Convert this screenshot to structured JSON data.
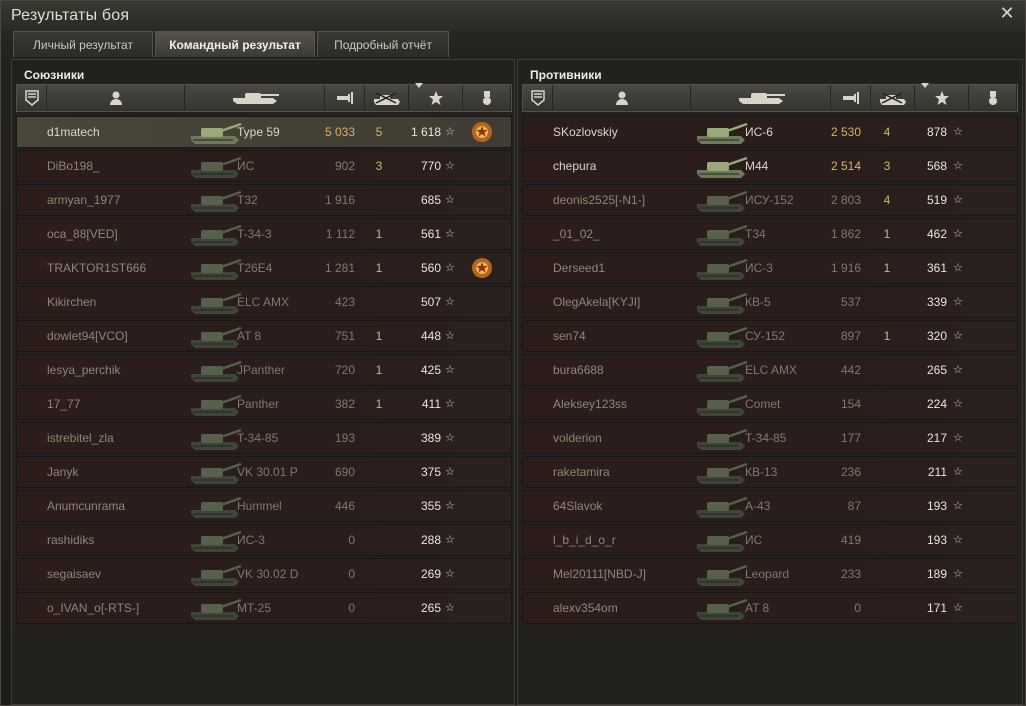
{
  "window": {
    "title": "Результаты боя"
  },
  "tabs": [
    {
      "label": "Личный результат",
      "active": false
    },
    {
      "label": "Командный результат",
      "active": true
    },
    {
      "label": "Подробный отчёт",
      "active": false
    }
  ],
  "colors": {
    "damage": "#d8b26a",
    "alive_text": "#d9d5c9",
    "dead_text": "#8e8676"
  },
  "allies": {
    "title": "Союзники",
    "rows": [
      {
        "name": "d1matech",
        "vehicle": "Type 59",
        "damage": "5 033",
        "kills": "5",
        "xp": "1 618",
        "alive": true,
        "medal": true,
        "me": true
      },
      {
        "name": "DiBo198_",
        "vehicle": "ИС",
        "damage": "902",
        "kills": "3",
        "xp": "770",
        "alive": false,
        "medal": false
      },
      {
        "name": "armyan_1977",
        "vehicle": "T32",
        "damage": "1 916",
        "kills": "",
        "xp": "685",
        "alive": false,
        "medal": false
      },
      {
        "name": "oca_88[VED]",
        "vehicle": "T-34-3",
        "damage": "1 112",
        "kills": "1",
        "xp": "561",
        "alive": false,
        "medal": false
      },
      {
        "name": "TRAKTOR1ST666",
        "vehicle": "T26E4",
        "damage": "1 281",
        "kills": "1",
        "xp": "560",
        "alive": false,
        "medal": true
      },
      {
        "name": "Kikirchen",
        "vehicle": "ELC AMX",
        "damage": "423",
        "kills": "",
        "xp": "507",
        "alive": false,
        "medal": false
      },
      {
        "name": "dowlet94[VCO]",
        "vehicle": "AT 8",
        "damage": "751",
        "kills": "1",
        "xp": "448",
        "alive": false,
        "medal": false
      },
      {
        "name": "lesya_perchik",
        "vehicle": "JPanther",
        "damage": "720",
        "kills": "1",
        "xp": "425",
        "alive": false,
        "medal": false
      },
      {
        "name": "17_77",
        "vehicle": "Panther",
        "damage": "382",
        "kills": "1",
        "xp": "411",
        "alive": false,
        "medal": false
      },
      {
        "name": "istrebitel_zla",
        "vehicle": "T-34-85",
        "damage": "193",
        "kills": "",
        "xp": "389",
        "alive": false,
        "medal": false
      },
      {
        "name": "Janyk",
        "vehicle": "VK 30.01 P",
        "damage": "690",
        "kills": "",
        "xp": "375",
        "alive": false,
        "medal": false
      },
      {
        "name": "Anumcunrama",
        "vehicle": "Hummel",
        "damage": "446",
        "kills": "",
        "xp": "355",
        "alive": false,
        "medal": false
      },
      {
        "name": "rashidiks",
        "vehicle": "ИС-3",
        "damage": "0",
        "kills": "",
        "xp": "288",
        "alive": false,
        "medal": false
      },
      {
        "name": "segaisaev",
        "vehicle": "VK 30.02 D",
        "damage": "0",
        "kills": "",
        "xp": "269",
        "alive": false,
        "medal": false
      },
      {
        "name": "o_IVAN_o[-RTS-]",
        "vehicle": "MT-25",
        "damage": "0",
        "kills": "",
        "xp": "265",
        "alive": false,
        "medal": false
      }
    ]
  },
  "enemies": {
    "title": "Противники",
    "rows": [
      {
        "name": "SKozlovskiy",
        "vehicle": "ИС-6",
        "damage": "2 530",
        "kills": "4",
        "xp": "878",
        "alive": true
      },
      {
        "name": "chepura",
        "vehicle": "M44",
        "damage": "2 514",
        "kills": "3",
        "xp": "568",
        "alive": true
      },
      {
        "name": "deonis2525[-N1-]",
        "vehicle": "ИСУ-152",
        "damage": "2 803",
        "kills": "4",
        "xp": "519",
        "alive": false
      },
      {
        "name": "_01_02_",
        "vehicle": "T34",
        "damage": "1 862",
        "kills": "1",
        "xp": "462",
        "alive": false
      },
      {
        "name": "Derseed1",
        "vehicle": "ИС-3",
        "damage": "1 916",
        "kills": "1",
        "xp": "361",
        "alive": false
      },
      {
        "name": "OlegAkela[KYJI]",
        "vehicle": "КВ-5",
        "damage": "537",
        "kills": "",
        "xp": "339",
        "alive": false
      },
      {
        "name": "sen74",
        "vehicle": "СУ-152",
        "damage": "897",
        "kills": "1",
        "xp": "320",
        "alive": false
      },
      {
        "name": "bura6688",
        "vehicle": "ELC AMX",
        "damage": "442",
        "kills": "",
        "xp": "265",
        "alive": false
      },
      {
        "name": "Aleksey123ss",
        "vehicle": "Comet",
        "damage": "154",
        "kills": "",
        "xp": "224",
        "alive": false
      },
      {
        "name": "volderion",
        "vehicle": "T-34-85",
        "damage": "177",
        "kills": "",
        "xp": "217",
        "alive": false
      },
      {
        "name": "raketamira",
        "vehicle": "КВ-13",
        "damage": "236",
        "kills": "",
        "xp": "211",
        "alive": false
      },
      {
        "name": "64Slavok",
        "vehicle": "A-43",
        "damage": "87",
        "kills": "",
        "xp": "193",
        "alive": false
      },
      {
        "name": "l_b_i_d_o_r",
        "vehicle": "ИС",
        "damage": "419",
        "kills": "",
        "xp": "193",
        "alive": false
      },
      {
        "name": "Mel20111[NBD-J]",
        "vehicle": "Leopard",
        "damage": "233",
        "kills": "",
        "xp": "189",
        "alive": false
      },
      {
        "name": "alexv354om",
        "vehicle": "AT 8",
        "damage": "0",
        "kills": "",
        "xp": "171",
        "alive": false
      }
    ]
  }
}
